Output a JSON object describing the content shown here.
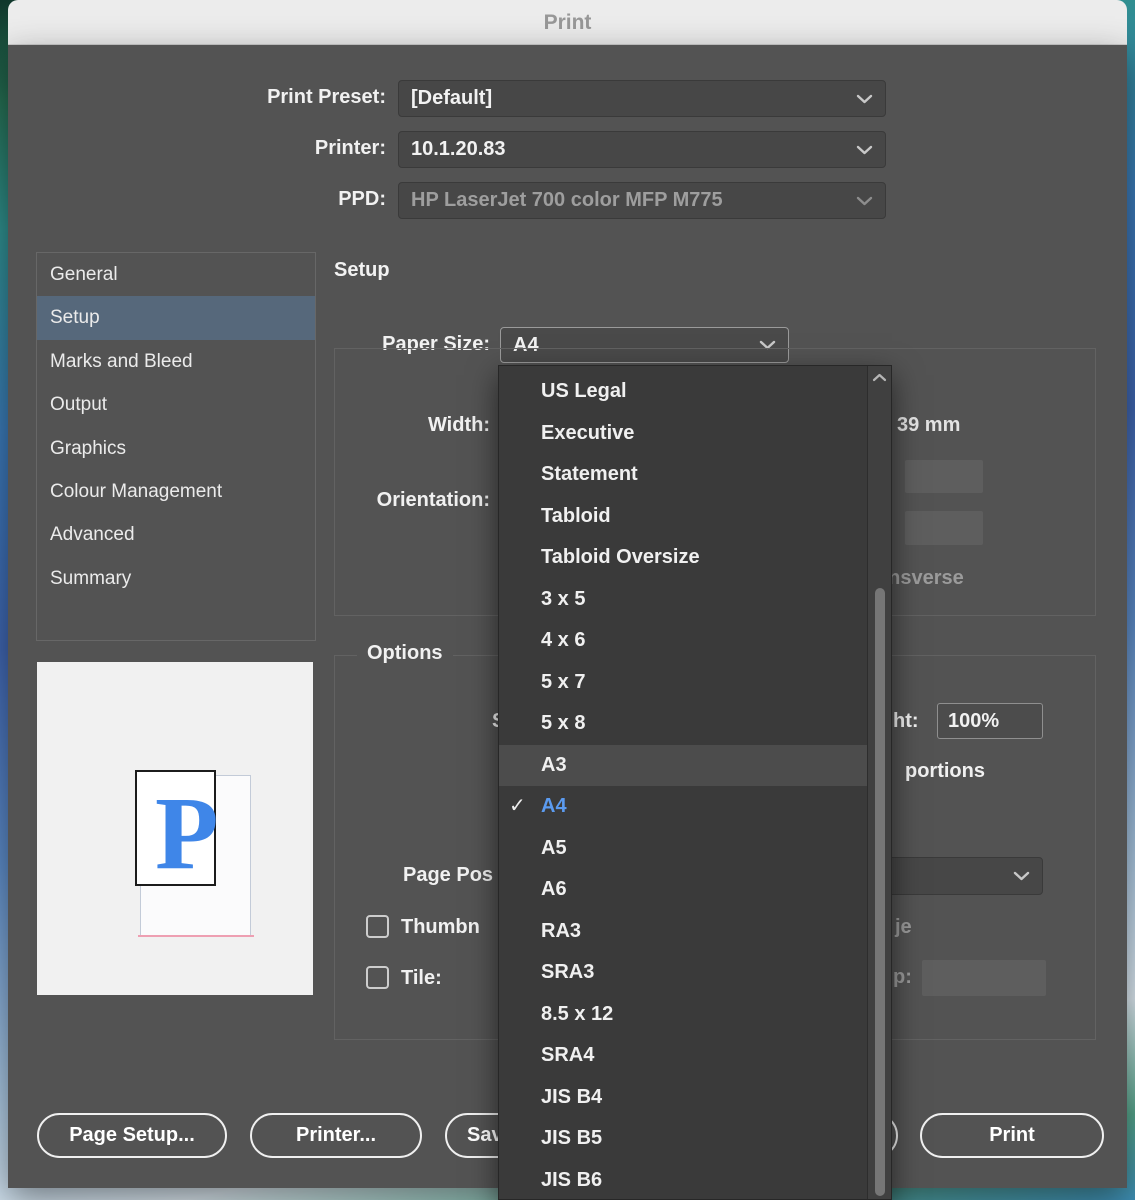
{
  "window": {
    "title": "Print"
  },
  "form": {
    "print_preset": {
      "label": "Print Preset:",
      "value": "[Default]"
    },
    "printer": {
      "label": "Printer:",
      "value": "10.1.20.83"
    },
    "ppd": {
      "label": "PPD:",
      "value": "HP LaserJet 700 color MFP M775"
    }
  },
  "sidebar": {
    "items": [
      "General",
      "Setup",
      "Marks and Bleed",
      "Output",
      "Graphics",
      "Colour Management",
      "Advanced",
      "Summary"
    ],
    "selected": "Setup"
  },
  "setup": {
    "section_title": "Setup",
    "paper_size_label": "Paper Size:",
    "paper_size_value": "A4",
    "width_label": "Width:",
    "height_value_partial": "39 mm",
    "orientation_label": "Orientation:",
    "transverse_partial": "ansverse",
    "options_title": "Options",
    "scale_partial": "S",
    "height_label_partial": "ht:",
    "scale_height_value": "100%",
    "proportions_partial": "portions",
    "page_position_partial": "Page Pos",
    "thumbnails_partial": "Thumbn",
    "per_page_partial": "je",
    "tile_label": "Tile:",
    "overlap_partial": "p:"
  },
  "paper_size_menu": {
    "checkmark": "✓",
    "items": [
      "US Legal",
      "Executive",
      "Statement",
      "Tabloid",
      "Tabloid Oversize",
      "3 x 5",
      "4 x 6",
      "5 x 7",
      "5 x 8",
      "A3",
      "A4",
      "A5",
      "A6",
      "RA3",
      "SRA3",
      "8.5 x 12",
      "SRA4",
      "JIS B4",
      "JIS B5",
      "JIS B6"
    ],
    "highlighted_item": "A3",
    "checked_item": "A4"
  },
  "preview": {
    "letter": "P"
  },
  "buttons": {
    "page_setup": "Page Setup...",
    "printer": "Printer...",
    "save_partial": "Sav",
    "print": "Print"
  },
  "colors": {
    "accent_blue": "#5b9bf0",
    "selected_row": "#56687b"
  }
}
